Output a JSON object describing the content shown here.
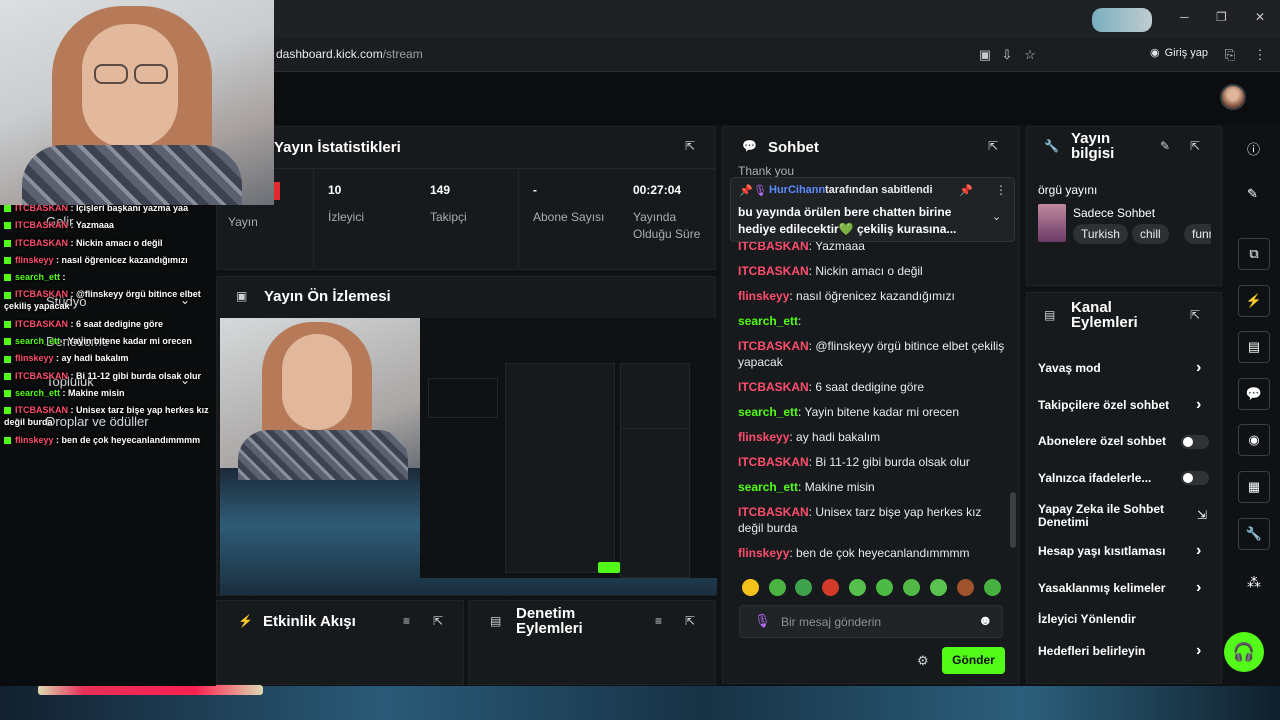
{
  "browser": {
    "url_host": "dashboard.kick.com",
    "url_path": "/stream",
    "login_label": "Giriş yap",
    "window_minimize": "─",
    "window_maximize": "❐",
    "window_close": "✕"
  },
  "stats_panel": {
    "title": "Yayın İstatistikleri",
    "stream_label": "Yayın",
    "viewers_value": "10",
    "viewers_label": "İzleyici",
    "followers_value": "149",
    "followers_label": "Takipçi",
    "subs_value": "-",
    "subs_label": "Abone Sayısı",
    "duration_value": "00:27:04",
    "duration_label": "Yayında Olduğu Süre"
  },
  "preview_panel": {
    "title": "Yayın Ön İzlemesi"
  },
  "activity_panel": {
    "title": "Etkinlik Akışı"
  },
  "moderation_panel": {
    "title": "Denetim Eylemleri"
  },
  "chat_panel": {
    "title": "Sohbet",
    "pinned_user": "HurCihann",
    "pinned_suffix": "tarafından sabitlendi",
    "pinned_text": "bu yayında örülen bere chatten birine hediye edilecektir💚 çekiliş kurasına...",
    "partial_top": "Thank you",
    "messages": [
      {
        "user": "ITCBASKAN",
        "text": "Yazmaaa",
        "color": "#ff4d6d"
      },
      {
        "user": "ITCBASKAN",
        "text": "Nickin amacı o değil",
        "color": "#ff4d6d"
      },
      {
        "user": "flinskeyy",
        "text": "nasıl öğrenicez kazandığımızı",
        "color": "#ff4d6d"
      },
      {
        "user": "search_ett",
        "text": "",
        "color": "#53fc18"
      },
      {
        "user": "ITCBASKAN",
        "text": "@flinskeyy örgü bitince elbet çekiliş yapacak",
        "color": "#ff4d6d"
      },
      {
        "user": "ITCBASKAN",
        "text": "6 saat dedigine göre",
        "color": "#ff4d6d"
      },
      {
        "user": "search_ett",
        "text": "Yayin bitene kadar mi orecen",
        "color": "#53fc18"
      },
      {
        "user": "flinskeyy",
        "text": "ay hadi bakalım",
        "color": "#ff4d6d"
      },
      {
        "user": "ITCBASKAN",
        "text": "Bi 11-12 gibi burda olsak olur",
        "color": "#ff4d6d"
      },
      {
        "user": "search_ett",
        "text": "Makine misin",
        "color": "#53fc18"
      },
      {
        "user": "ITCBASKAN",
        "text": "Unisex tarz bişe yap herkes kız değil burda",
        "color": "#ff4d6d"
      },
      {
        "user": "flinskeyy",
        "text": "ben de çok heyecanlandımmmm",
        "color": "#ff4d6d"
      }
    ],
    "input_placeholder": "Bir mesaj gönderin",
    "send_label": "Gönder"
  },
  "stream_info_panel": {
    "title": "Yayın bilgisi",
    "stream_title": "örgü yayını",
    "category": "Sadece Sohbet",
    "tags": [
      "Turkish",
      "chill",
      "funny"
    ]
  },
  "channel_actions_panel": {
    "title": "Kanal Eylemleri",
    "items": [
      {
        "label": "Yavaş mod",
        "control": "chevron"
      },
      {
        "label": "Takipçilere özel sohbet",
        "control": "chevron"
      },
      {
        "label": "Abonelere özel sohbet",
        "control": "toggle"
      },
      {
        "label": "Yalnızca ifadelerle...",
        "control": "toggle"
      },
      {
        "label": "Yapay Zeka ile Sohbet Denetimi",
        "control": "external"
      },
      {
        "label": "Hesap yaşı kısıtlaması",
        "control": "chevron"
      },
      {
        "label": "Yasaklanmış kelimeler",
        "control": "chevron"
      },
      {
        "label": "İzleyici Yönlendir",
        "control": "none"
      },
      {
        "label": "Hedefleri belirleyin",
        "control": "chevron"
      }
    ]
  },
  "overlay_chat": [
    {
      "user": "ITCBASKAN",
      "text": "İçişleri başkanı yazma yaa"
    },
    {
      "user": "ITCBASKAN",
      "text": "Yazmaaa"
    },
    {
      "user": "ITCBASKAN",
      "text": "Nickin amacı o değil"
    },
    {
      "user": "flinskeyy",
      "text": "nasıl öğrenicez kazandığımızı"
    },
    {
      "user": "search_ett",
      "text": ""
    },
    {
      "user": "ITCBASKAN",
      "text": "@flinskeyy örgü bitince elbet çekiliş yapacak"
    },
    {
      "user": "ITCBASKAN",
      "text": "6 saat dedigine göre"
    },
    {
      "user": "search_ett",
      "text": "Yayin bitene kadar mi orecen"
    },
    {
      "user": "flinskeyy",
      "text": "ay hadi bakalım"
    },
    {
      "user": "ITCBASKAN",
      "text": "Bi 11-12 gibi burda olsak olur"
    },
    {
      "user": "search_ett",
      "text": "Makine misin"
    },
    {
      "user": "ITCBASKAN",
      "text": "Unisex tarz bişe yap herkes kız değil burda"
    },
    {
      "user": "flinskeyy",
      "text": "ben de çok heyecanlandımmmm"
    }
  ],
  "ghost_sidebar": {
    "item1": "Gelir",
    "item2": "Stüdyo",
    "item3": "Denetleme",
    "item4": "Topluluk",
    "item5": "Droplar ve ödüller"
  },
  "colors": {
    "accent": "#53fc18",
    "username_red": "#ff4d6d",
    "panel_bg": "#171a1c"
  }
}
